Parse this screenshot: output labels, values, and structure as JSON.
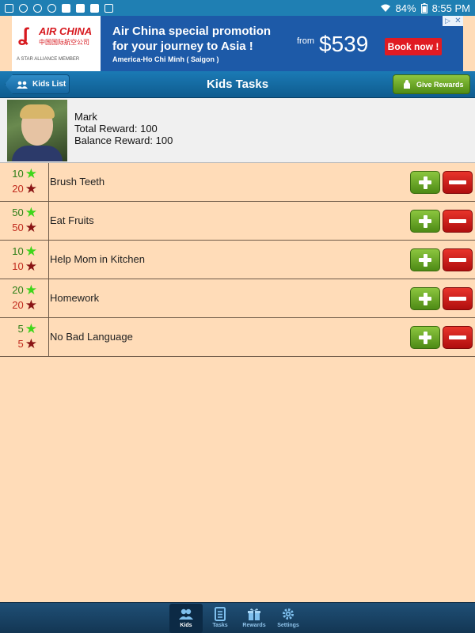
{
  "status_bar": {
    "battery": "84%",
    "time": "8:55 PM"
  },
  "ad": {
    "brand": "AIR CHINA",
    "brand_cn": "中国国际航空公司",
    "member": "A STAR ALLIANCE MEMBER",
    "headline_1": "Air China special promotion",
    "headline_2": "for your journey to Asia !",
    "route": "America-Ho Chi Minh ( Saigon )",
    "from": "from",
    "price": "$539",
    "cta": "Book now !"
  },
  "header": {
    "back_label": "Kids List",
    "title": "Kids Tasks",
    "rewards_label": "Give Rewards"
  },
  "kid": {
    "name": "Mark",
    "total_reward": "Total Reward: 100",
    "balance_reward": "Balance Reward: 100"
  },
  "tasks": [
    {
      "earn": "10",
      "lose": "20",
      "name": "Brush Teeth"
    },
    {
      "earn": "50",
      "lose": "50",
      "name": "Eat Fruits"
    },
    {
      "earn": "10",
      "lose": "10",
      "name": "Help Mom in Kitchen"
    },
    {
      "earn": "20",
      "lose": "20",
      "name": "Homework"
    },
    {
      "earn": "5",
      "lose": "5",
      "name": "No Bad Language"
    }
  ],
  "nav": {
    "items": [
      {
        "label": "Kids",
        "icon": "kids-icon"
      },
      {
        "label": "Tasks",
        "icon": "tasks-icon"
      },
      {
        "label": "Rewards",
        "icon": "gift-icon"
      },
      {
        "label": "Settings",
        "icon": "gear-icon"
      }
    ]
  },
  "colors": {
    "header": "#1b7ab5",
    "background": "#ffdcb8",
    "plus_button": "#6fae2c",
    "minus_button": "#d0201b",
    "earn_text": "#2f7f18",
    "lose_text": "#c12a1d"
  }
}
